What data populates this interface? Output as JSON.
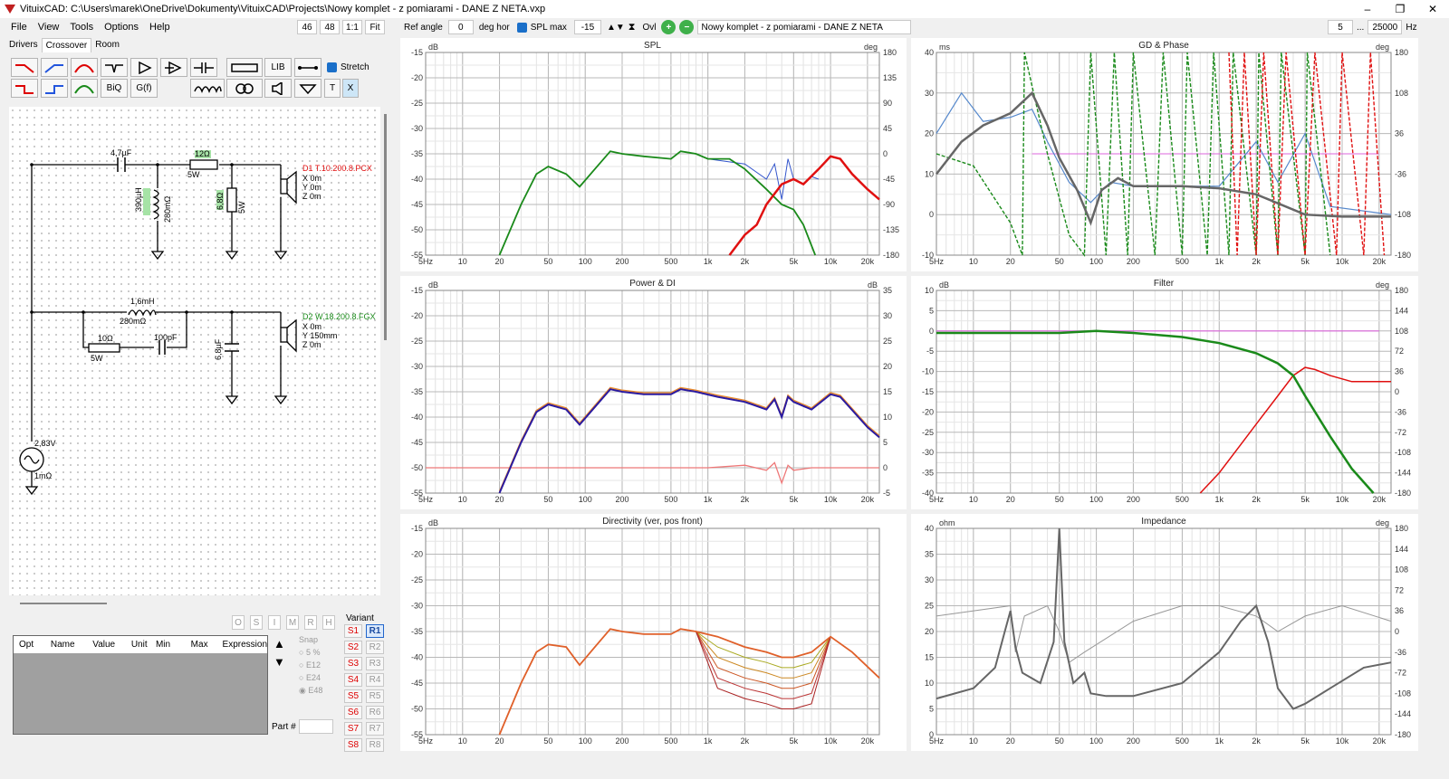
{
  "window": {
    "title": "VituixCAD: C:\\Users\\marek\\OneDrive\\Dokumenty\\VituixCAD\\Projects\\Nowy komplet - z pomiarami - DANE Z NETA.vxp",
    "minimize": "–",
    "maximize": "❐",
    "close": "✕"
  },
  "menu": [
    "File",
    "View",
    "Tools",
    "Options",
    "Help"
  ],
  "tabs": [
    "Drivers",
    "Crossover",
    "Room"
  ],
  "zoom": {
    "a": "46",
    "b": "48",
    "c": "1:1",
    "d": "Fit"
  },
  "toolbar": {
    "ref_angle_label": "Ref angle",
    "ref_angle_value": "0",
    "deg_hor": "deg hor",
    "spl_max_label": "SPL max",
    "spl_max_value": "-15",
    "ovl": "Ovl",
    "plus": "+",
    "minus": "−",
    "project_name": "Nowy komplet - z pomiarami - DANE Z NETA",
    "freq_min": "5",
    "dots": "...",
    "freq_max": "25000",
    "hz": "Hz"
  },
  "tools": {
    "lib": "LIB",
    "stretch": "Stretch",
    "biq": "BiQ",
    "gf": "G(f)",
    "t": "T",
    "x": "X"
  },
  "schematic": {
    "c1": "4,7µF",
    "r1": "12Ω",
    "r1_w": "5W",
    "l1": "390µH",
    "l1_r": "280mΩ",
    "r2": "6,8Ω",
    "r2_w": "5W",
    "d1_name": "D1 T.10.200.8.PCX",
    "d1_x": "X 0m",
    "d1_y": "Y 0m",
    "d1_z": "Z 0m",
    "l2": "1,6mH",
    "l2_r": "280mΩ",
    "r3": "10Ω",
    "r3_w": "5W",
    "c3": "100pF",
    "c2": "6,8µF",
    "d2_name": "D2 W.18.200.8.FGX",
    "d2_x": "X 0m",
    "d2_y": "Y 150mm",
    "d2_z": "Z 0m",
    "src_v": "2,83V",
    "src_r": "1mΩ"
  },
  "optimizer": {
    "flags": [
      "O",
      "S",
      "I",
      "M",
      "R",
      "H"
    ],
    "columns": [
      "Opt",
      "Name",
      "Value",
      "Unit",
      "Min",
      "Max",
      "Expression"
    ],
    "snap_label": "Snap",
    "snap": [
      "5 %",
      "E12",
      "E24",
      "E48"
    ],
    "part_label": "Part #"
  },
  "variant": {
    "label": "Variant",
    "s": [
      "S1",
      "S2",
      "S3",
      "S4",
      "S5",
      "S6",
      "S7",
      "S8"
    ],
    "r": [
      "R1",
      "R2",
      "R3",
      "R4",
      "R5",
      "R6",
      "R7",
      "R8"
    ]
  },
  "freq_ticks": [
    "5Hz",
    "10",
    "20",
    "50",
    "100",
    "200",
    "500",
    "1k",
    "2k",
    "5k",
    "10k",
    "20k"
  ],
  "plots": {
    "spl": {
      "title": "SPL",
      "left_unit": "dB",
      "right_unit": "deg",
      "left_ticks": [
        "-15",
        "-20",
        "-25",
        "-30",
        "-35",
        "-40",
        "-45",
        "-50",
        "-55"
      ],
      "right_ticks": [
        "180",
        "135",
        "90",
        "45",
        "0",
        "-45",
        "-90",
        "-135",
        "-180"
      ]
    },
    "gd": {
      "title": "GD & Phase",
      "left_unit": "ms",
      "right_unit": "deg",
      "left_ticks": [
        "40",
        "30",
        "20",
        "10",
        "0",
        "-10"
      ],
      "right_ticks": [
        "180",
        "108",
        "36",
        "-36",
        "-108",
        "-180"
      ]
    },
    "power": {
      "title": "Power & DI",
      "left_unit": "dB",
      "right_unit": "dB",
      "left_ticks": [
        "-15",
        "-20",
        "-25",
        "-30",
        "-35",
        "-40",
        "-45",
        "-50",
        "-55"
      ],
      "right_ticks": [
        "35",
        "30",
        "25",
        "20",
        "15",
        "10",
        "5",
        "0",
        "-5"
      ]
    },
    "filter": {
      "title": "Filter",
      "left_unit": "dB",
      "right_unit": "deg",
      "left_ticks": [
        "10",
        "5",
        "0",
        "-5",
        "-10",
        "-15",
        "-20",
        "-25",
        "-30",
        "-35",
        "-40"
      ],
      "right_ticks": [
        "180",
        "144",
        "108",
        "72",
        "36",
        "0",
        "-36",
        "-72",
        "-108",
        "-144",
        "-180"
      ]
    },
    "dir": {
      "title": "Directivity (ver, pos front)",
      "left_unit": "dB",
      "right_unit": "",
      "left_ticks": [
        "-15",
        "-20",
        "-25",
        "-30",
        "-35",
        "-40",
        "-45",
        "-50",
        "-55"
      ],
      "right_ticks": []
    },
    "imp": {
      "title": "Impedance",
      "left_unit": "ohm",
      "right_unit": "deg",
      "left_ticks": [
        "40",
        "35",
        "30",
        "25",
        "20",
        "15",
        "10",
        "5",
        "0"
      ],
      "right_ticks": [
        "180",
        "144",
        "108",
        "72",
        "36",
        "0",
        "-36",
        "-72",
        "-108",
        "-144",
        "-180"
      ]
    }
  },
  "colors": {
    "woofer": "#1a8a1a",
    "tweeter": "#e01010",
    "sum_blue": "#3355cc",
    "power": "#2a1aa0",
    "pink": "#dd66dd",
    "grey": "#666666"
  }
}
